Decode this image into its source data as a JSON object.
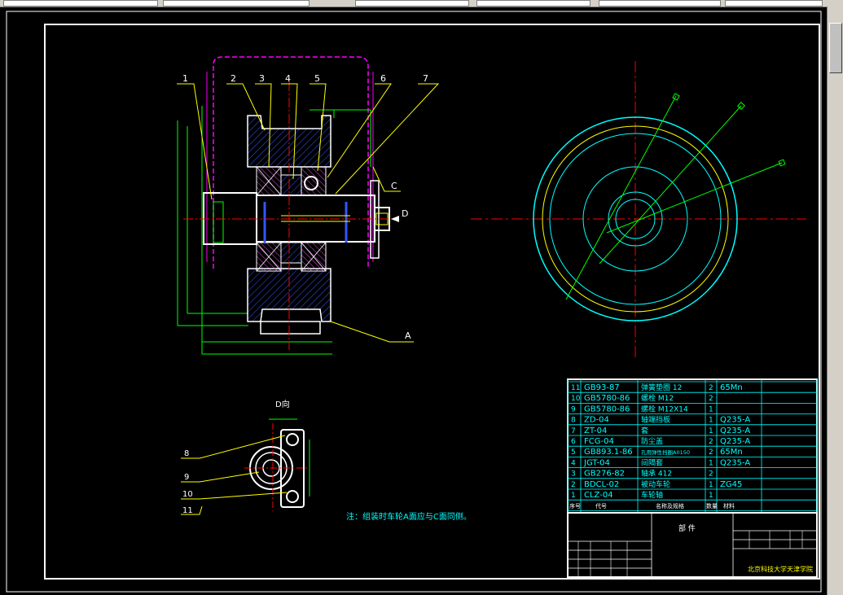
{
  "app": {
    "title": ""
  },
  "drawing": {
    "leaders": [
      "1",
      "2",
      "3",
      "4",
      "5",
      "6",
      "7"
    ],
    "label_a": "A",
    "label_c": "C",
    "label_d": "D",
    "detail_title": "D向",
    "detail_leaders": [
      "8",
      "9",
      "10",
      "11"
    ],
    "note": "注：组装时车轮A面应与C面同侧。"
  },
  "bom": {
    "rows": [
      {
        "no": "11",
        "code": "GB93-87",
        "name": "弹簧垫圈 12",
        "qty": "2",
        "material": "65Mn"
      },
      {
        "no": "10",
        "code": "GB5780-86",
        "name": "螺栓 M12",
        "qty": "2",
        "material": ""
      },
      {
        "no": "9",
        "code": "GB5780-86",
        "name": "螺栓 M12X14",
        "qty": "1",
        "material": ""
      },
      {
        "no": "8",
        "code": "ZD-04",
        "name": "轴端挡板",
        "qty": "1",
        "material": "Q235-A"
      },
      {
        "no": "7",
        "code": "ZT-04",
        "name": "套",
        "qty": "1",
        "material": "Q235-A"
      },
      {
        "no": "6",
        "code": "FCG-04",
        "name": "防尘盖",
        "qty": "2",
        "material": "Q235-A"
      },
      {
        "no": "5",
        "code": "GB893.1-86",
        "name": "孔用弹性挡圈A0150",
        "qty": "2",
        "material": "65Mn"
      },
      {
        "no": "4",
        "code": "JGT-04",
        "name": "间隔套",
        "qty": "1",
        "material": "Q235-A"
      },
      {
        "no": "3",
        "code": "GB276-82",
        "name": "轴承 412",
        "qty": "2",
        "material": ""
      },
      {
        "no": "2",
        "code": "BDCL-02",
        "name": "被动车轮",
        "qty": "1",
        "material": "ZG45"
      },
      {
        "no": "1",
        "code": "CLZ-04",
        "name": "车轮轴",
        "qty": "1",
        "material": ""
      }
    ],
    "header": {
      "no": "序号",
      "code": "代号",
      "name": "名称及规格",
      "qty": "数量",
      "material": "材料"
    }
  },
  "title_block": {
    "part_name": "部  件",
    "school": "北京科技大学天津学院"
  }
}
